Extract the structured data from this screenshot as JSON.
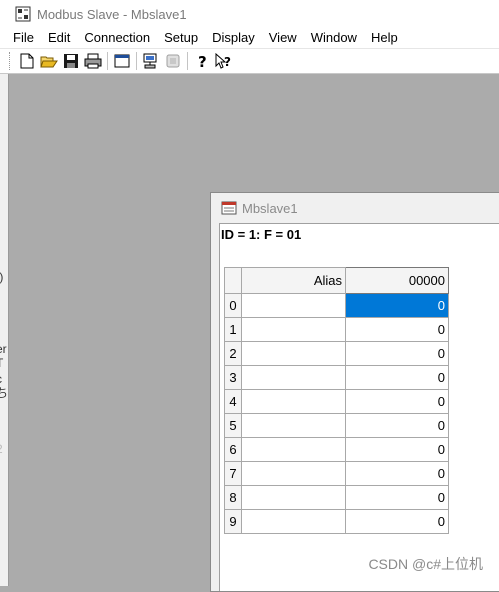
{
  "window": {
    "title": "Modbus Slave - Mbslave1",
    "icon": "modbus-app-icon"
  },
  "menu": [
    "File",
    "Edit",
    "Connection",
    "Setup",
    "Display",
    "View",
    "Window",
    "Help"
  ],
  "toolbar": {
    "buttons": [
      "new-icon",
      "open-icon",
      "save-icon",
      "print-icon",
      "window-icon",
      "connect-icon",
      "disconnect-icon",
      "help-icon",
      "context-help-icon"
    ]
  },
  "left_strip": {
    "fragments": [
      "])",
      "er",
      "T",
      "c",
      "ち",
      "2"
    ]
  },
  "child_window": {
    "title": "Mbslave1",
    "id_line": "ID = 1: F = 01",
    "columns": [
      "Alias",
      "00000"
    ],
    "rows": [
      {
        "index": "0",
        "alias": "",
        "value": "0",
        "selected": true
      },
      {
        "index": "1",
        "alias": "",
        "value": "0"
      },
      {
        "index": "2",
        "alias": "",
        "value": "0"
      },
      {
        "index": "3",
        "alias": "",
        "value": "0"
      },
      {
        "index": "4",
        "alias": "",
        "value": "0"
      },
      {
        "index": "5",
        "alias": "",
        "value": "0"
      },
      {
        "index": "6",
        "alias": "",
        "value": "0"
      },
      {
        "index": "7",
        "alias": "",
        "value": "0"
      },
      {
        "index": "8",
        "alias": "",
        "value": "0"
      },
      {
        "index": "9",
        "alias": "",
        "value": "0"
      }
    ]
  },
  "watermark": "CSDN @c#上位机",
  "colors": {
    "selection": "#0078d7",
    "workspace": "#ababab"
  }
}
